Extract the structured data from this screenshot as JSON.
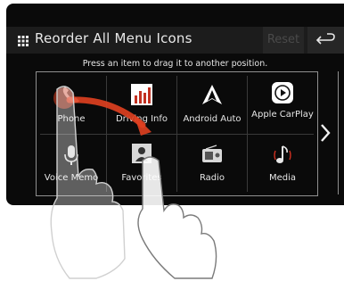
{
  "header": {
    "title": "Reorder All Menu Icons",
    "reset_label": "Reset",
    "back_icon": "back-arrow-icon",
    "menu_icon": "grid-icon"
  },
  "instruction": "Press an item to drag it to another position.",
  "menu_items": [
    {
      "label": "Phone",
      "icon": "phone-icon"
    },
    {
      "label": "Driving Info",
      "icon": "bar-chart-icon"
    },
    {
      "label": "Android Auto",
      "icon": "android-auto-icon"
    },
    {
      "label": "Apple CarPlay",
      "icon": "carplay-icon"
    },
    {
      "label": "Voice Memo",
      "icon": "microphone-icon"
    },
    {
      "label": "Favorites",
      "icon": "contact-icon"
    },
    {
      "label": "Radio",
      "icon": "radio-icon"
    },
    {
      "label": "Media",
      "icon": "music-note-icon"
    }
  ],
  "navigation": {
    "next_icon": "chevron-right-icon"
  },
  "colors": {
    "background": "#0a0a0a",
    "header": "#1c1c1c",
    "text": "#e6e6e6",
    "accent": "#e04020"
  }
}
